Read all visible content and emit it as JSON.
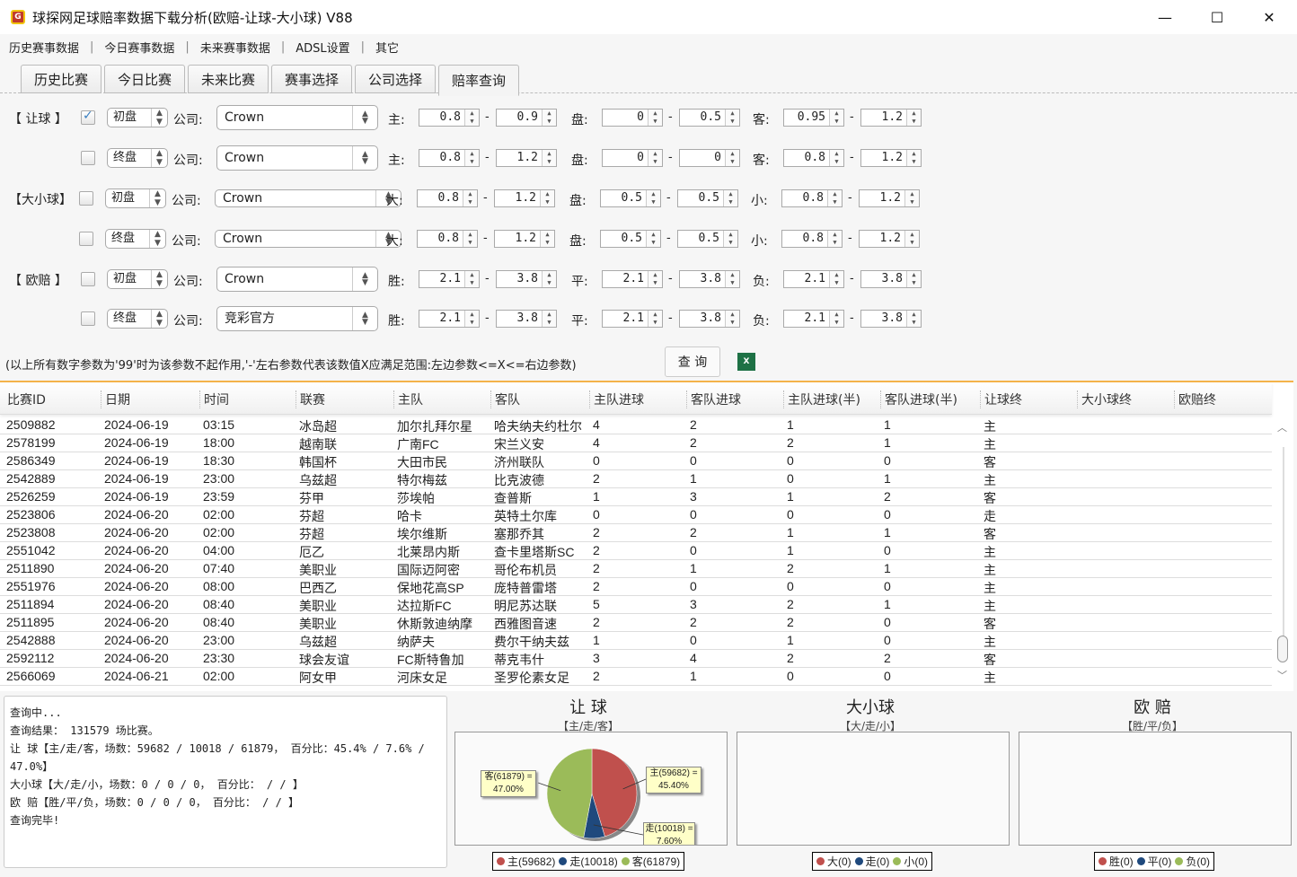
{
  "window": {
    "title": "球探网足球赔率数据下载分析(欧赔-让球-大小球) V88",
    "icon": "bull-logo-icon",
    "controls": {
      "minimize": "—",
      "maximize": "☐",
      "close": "✕"
    }
  },
  "menu": [
    "历史赛事数据",
    "今日赛事数据",
    "未来赛事数据",
    "ADSL设置",
    "其它"
  ],
  "menu_separator": "|",
  "tabs": [
    {
      "label": "历史比赛",
      "active": false
    },
    {
      "label": "今日比赛",
      "active": false
    },
    {
      "label": "未来比赛",
      "active": false
    },
    {
      "label": "赛事选择",
      "active": false
    },
    {
      "label": "公司选择",
      "active": false
    },
    {
      "label": "赔率查询",
      "active": true
    }
  ],
  "filters": {
    "company_label": "公司:",
    "range_dash": "-",
    "rows": [
      {
        "group": "【 让球 】",
        "checked": true,
        "phase": "初盘",
        "company": "Crown",
        "f1": "主:",
        "a1": "0.8",
        "b1": "0.9",
        "f2": "盘:",
        "a2": "0",
        "b2": "0.5",
        "f3": "客:",
        "a3": "0.95",
        "b3": "1.2"
      },
      {
        "group": "",
        "checked": false,
        "phase": "终盘",
        "company": "Crown",
        "f1": "主:",
        "a1": "0.8",
        "b1": "1.2",
        "f2": "盘:",
        "a2": "0",
        "b2": "0",
        "f3": "客:",
        "a3": "0.8",
        "b3": "1.2"
      },
      {
        "group": "【大小球】",
        "checked": false,
        "phase": "初盘",
        "company": "Crown",
        "f1": "大:",
        "a1": "0.8",
        "b1": "1.2",
        "f2": "盘:",
        "a2": "0.5",
        "b2": "0.5",
        "f3": "小:",
        "a3": "0.8",
        "b3": "1.2"
      },
      {
        "group": "",
        "checked": false,
        "phase": "终盘",
        "company": "Crown",
        "f1": "大:",
        "a1": "0.8",
        "b1": "1.2",
        "f2": "盘:",
        "a2": "0.5",
        "b2": "0.5",
        "f3": "小:",
        "a3": "0.8",
        "b3": "1.2"
      },
      {
        "group": "【 欧赔 】",
        "checked": false,
        "phase": "初盘",
        "company": "Crown",
        "f1": "胜:",
        "a1": "2.1",
        "b1": "3.8",
        "f2": "平:",
        "a2": "2.1",
        "b2": "3.8",
        "f3": "负:",
        "a3": "2.1",
        "b3": "3.8"
      },
      {
        "group": "",
        "checked": false,
        "phase": "终盘",
        "company": "竞彩官方",
        "f1": "胜:",
        "a1": "2.1",
        "b1": "3.8",
        "f2": "平:",
        "a2": "2.1",
        "b2": "3.8",
        "f3": "负:",
        "a3": "2.1",
        "b3": "3.8"
      }
    ],
    "note": "(以上所有数字参数为'99'时为该参数不起作用,'-'左右参数代表该数值X应满足范围:左边参数<=X<=右边参数)",
    "query_button": "查 询",
    "export_icon": "excel-icon"
  },
  "table": {
    "columns": [
      "比赛ID",
      "日期",
      "时间",
      "联赛",
      "主队",
      "客队",
      "主队进球",
      "客队进球",
      "主队进球(半)",
      "客队进球(半)",
      "让球终",
      "大小球终",
      "欧赔终"
    ],
    "rows": [
      [
        "2509882",
        "2024-06-19",
        "03:15",
        "冰岛超",
        "加尔扎拜尔星",
        "哈夫纳夫约杜尔",
        "4",
        "2",
        "1",
        "1",
        "主",
        "",
        ""
      ],
      [
        "2578199",
        "2024-06-19",
        "18:00",
        "越南联",
        "广南FC",
        "宋兰义安",
        "4",
        "2",
        "2",
        "1",
        "主",
        "",
        ""
      ],
      [
        "2586349",
        "2024-06-19",
        "18:30",
        "韩国杯",
        "大田市民",
        "济州联队",
        "0",
        "0",
        "0",
        "0",
        "客",
        "",
        ""
      ],
      [
        "2542889",
        "2024-06-19",
        "23:00",
        "乌兹超",
        "特尔梅兹",
        "比克波德",
        "2",
        "1",
        "0",
        "1",
        "主",
        "",
        ""
      ],
      [
        "2526259",
        "2024-06-19",
        "23:59",
        "芬甲",
        "莎埃帕",
        "查普斯",
        "1",
        "3",
        "1",
        "2",
        "客",
        "",
        ""
      ],
      [
        "2523806",
        "2024-06-20",
        "02:00",
        "芬超",
        "哈卡",
        "英特土尔库",
        "0",
        "0",
        "0",
        "0",
        "走",
        "",
        ""
      ],
      [
        "2523808",
        "2024-06-20",
        "02:00",
        "芬超",
        "埃尔维斯",
        "塞那乔其",
        "2",
        "2",
        "1",
        "1",
        "客",
        "",
        ""
      ],
      [
        "2551042",
        "2024-06-20",
        "04:00",
        "厄乙",
        "北莱昂内斯",
        "查卡里塔斯SC",
        "2",
        "0",
        "1",
        "0",
        "主",
        "",
        ""
      ],
      [
        "2511890",
        "2024-06-20",
        "07:40",
        "美职业",
        "国际迈阿密",
        "哥伦布机员",
        "2",
        "1",
        "2",
        "1",
        "主",
        "",
        ""
      ],
      [
        "2551976",
        "2024-06-20",
        "08:00",
        "巴西乙",
        "保地花高SP",
        "庞特普雷塔",
        "2",
        "0",
        "0",
        "0",
        "主",
        "",
        ""
      ],
      [
        "2511894",
        "2024-06-20",
        "08:40",
        "美职业",
        "达拉斯FC",
        "明尼苏达联",
        "5",
        "3",
        "2",
        "1",
        "主",
        "",
        ""
      ],
      [
        "2511895",
        "2024-06-20",
        "08:40",
        "美职业",
        "休斯敦迪纳摩",
        "西雅图音速",
        "2",
        "2",
        "2",
        "0",
        "客",
        "",
        ""
      ],
      [
        "2542888",
        "2024-06-20",
        "23:00",
        "乌兹超",
        "纳萨夫",
        "费尔干纳夫兹",
        "1",
        "0",
        "1",
        "0",
        "主",
        "",
        ""
      ],
      [
        "2592112",
        "2024-06-20",
        "23:30",
        "球会友谊",
        "FC斯特鲁加",
        "蒂克韦什",
        "3",
        "4",
        "2",
        "2",
        "客",
        "",
        ""
      ],
      [
        "2566069",
        "2024-06-21",
        "02:00",
        "阿女甲",
        "河床女足",
        "圣罗伦素女足",
        "2",
        "1",
        "0",
        "0",
        "主",
        "",
        ""
      ]
    ]
  },
  "log": [
    "查询中...",
    "查询结果： 131579 场比赛。",
    "让  球【主/走/客，场数：59682 / 10018 / 61879， 百分比：45.4% / 7.6% /",
    "47.0%】",
    "大小球【大/走/小，场数：0 / 0 / 0， 百分比： /  / 】",
    "欧  赔【胜/平/负，场数：0 / 0 / 0， 百分比： /  / 】",
    "查询完毕!"
  ],
  "colors": {
    "c1": "#c0504d",
    "c2": "#1f497d",
    "c3": "#9bbb59",
    "accent": "#f4b34a"
  },
  "chart_data": [
    {
      "type": "pie",
      "title": "让 球",
      "subtitle": "【主/走/客】",
      "categories": [
        "主",
        "走",
        "客"
      ],
      "values": [
        59682,
        10018,
        61879
      ],
      "percents": [
        45.4,
        7.6,
        47.0
      ],
      "labels": [
        "主(59682) =",
        "走(10018) =",
        "客(61879) ="
      ],
      "percent_labels": [
        "45.40%",
        "7.60%",
        "47.00%"
      ],
      "legend": [
        "主(59682)",
        "走(10018)",
        "客(61879)"
      ],
      "legend_position": "bottom"
    },
    {
      "type": "pie",
      "title": "大小球",
      "subtitle": "【大/走/小】",
      "categories": [
        "大",
        "走",
        "小"
      ],
      "values": [
        0,
        0,
        0
      ],
      "legend": [
        "大(0)",
        "走(0)",
        "小(0)"
      ],
      "legend_position": "bottom"
    },
    {
      "type": "pie",
      "title": "欧 赔",
      "subtitle": "【胜/平/负】",
      "categories": [
        "胜",
        "平",
        "负"
      ],
      "values": [
        0,
        0,
        0
      ],
      "legend": [
        "胜(0)",
        "平(0)",
        "负(0)"
      ],
      "legend_position": "bottom"
    }
  ]
}
